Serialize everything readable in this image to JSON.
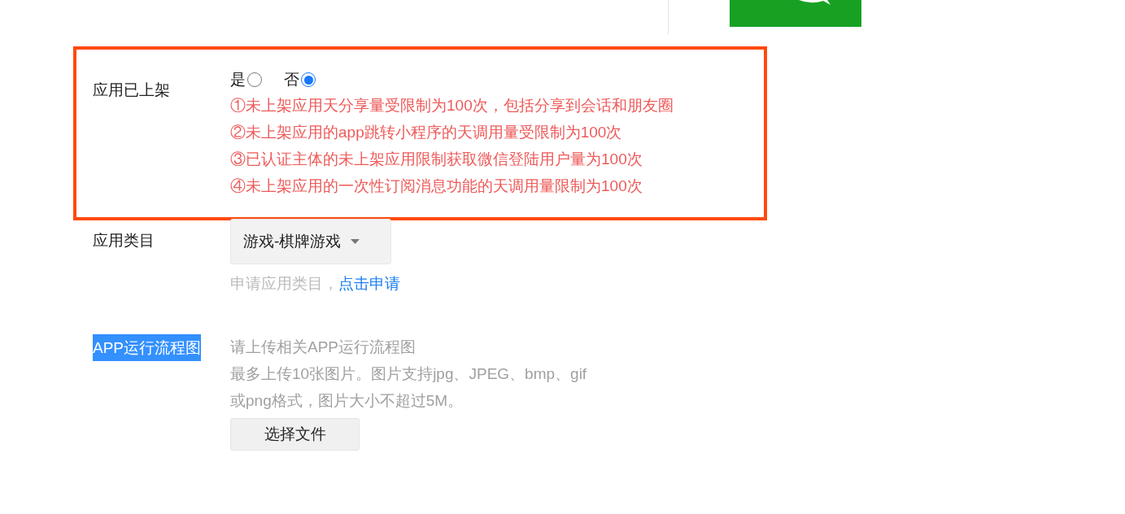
{
  "listed": {
    "label": "应用已上架",
    "options": [
      {
        "label": "是",
        "selected": false
      },
      {
        "label": "否",
        "selected": true
      }
    ],
    "notes": [
      "①未上架应用天分享量受限制为100次，包括分享到会话和朋友圈",
      "②未上架应用的app跳转小程序的天调用量受限制为100次",
      "③已认证主体的未上架应用限制获取微信登陆用户量为100次",
      "④未上架应用的一次性订阅消息功能的天调用量限制为100次"
    ]
  },
  "category": {
    "label": "应用类目",
    "value": "游戏-棋牌游戏",
    "hint": "申请应用类目，",
    "link": "点击申请"
  },
  "flowchart": {
    "label": "APP运行流程图",
    "highlighted": true,
    "lines": [
      "请上传相关APP运行流程图",
      "最多上传10张图片。图片支持jpg、JPEG、bmp、gif",
      "或png格式，图片大小不超过5M。"
    ],
    "button": "选择文件"
  }
}
